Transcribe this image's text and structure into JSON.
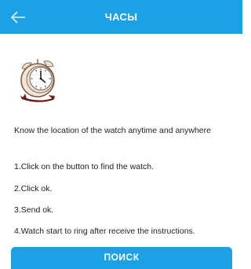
{
  "header": {
    "title": "ЧАСЫ",
    "back_icon": "arrow-left-icon",
    "background_color": "#1aa1e6"
  },
  "illustration": {
    "icon": "alarm-clock-icon"
  },
  "content": {
    "intro": "Know the location of the watch anytime and anywhere",
    "steps": [
      "1.Click on the button to find the watch.",
      "2.Click ok.",
      "3.Send ok.",
      "4.Watch start to ring after receive the instructions."
    ]
  },
  "action": {
    "find_label": "ПОИСК",
    "color": "#1aa1e6"
  }
}
